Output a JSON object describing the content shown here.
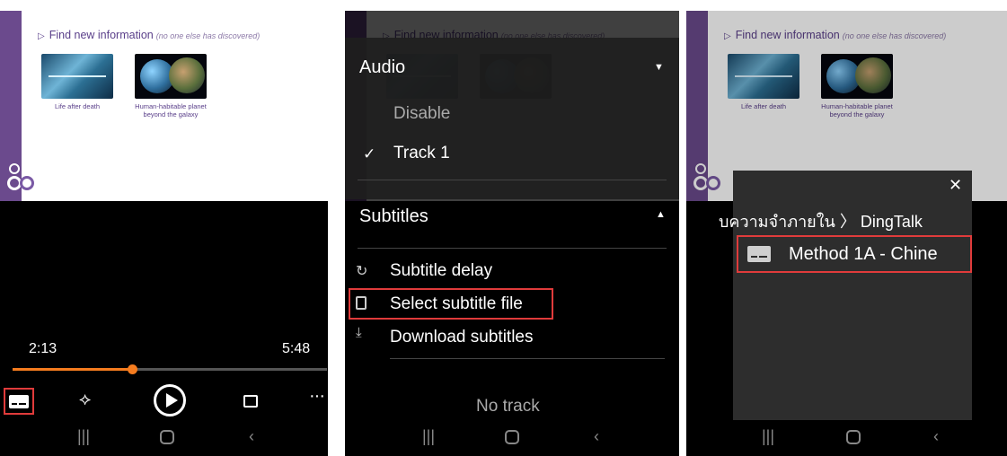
{
  "slide": {
    "heading": "Find new information",
    "heading_note": "(no one else has discovered)",
    "caption1": "Life after death",
    "caption2": "Human-habitable planet beyond the galaxy"
  },
  "player": {
    "time_current": "2:13",
    "time_total": "5:48",
    "progress_fraction": 0.38
  },
  "menu": {
    "audio_title": "Audio",
    "audio_options": [
      "Disable",
      "Track 1"
    ],
    "subtitles_title": "Subtitles",
    "subtitle_delay": "Subtitle delay",
    "select_subtitle_file": "Select subtitle file",
    "download_subtitles": "Download subtitles",
    "no_track": "No track"
  },
  "file_dialog": {
    "breadcrumb": "บความจำภายใน 〉 DingTalk",
    "file_name": "Method 1A - Chine"
  },
  "colors": {
    "accent": "#f57c1f",
    "highlight": "#e03b3b",
    "slide_purple": "#6b4a8d"
  }
}
